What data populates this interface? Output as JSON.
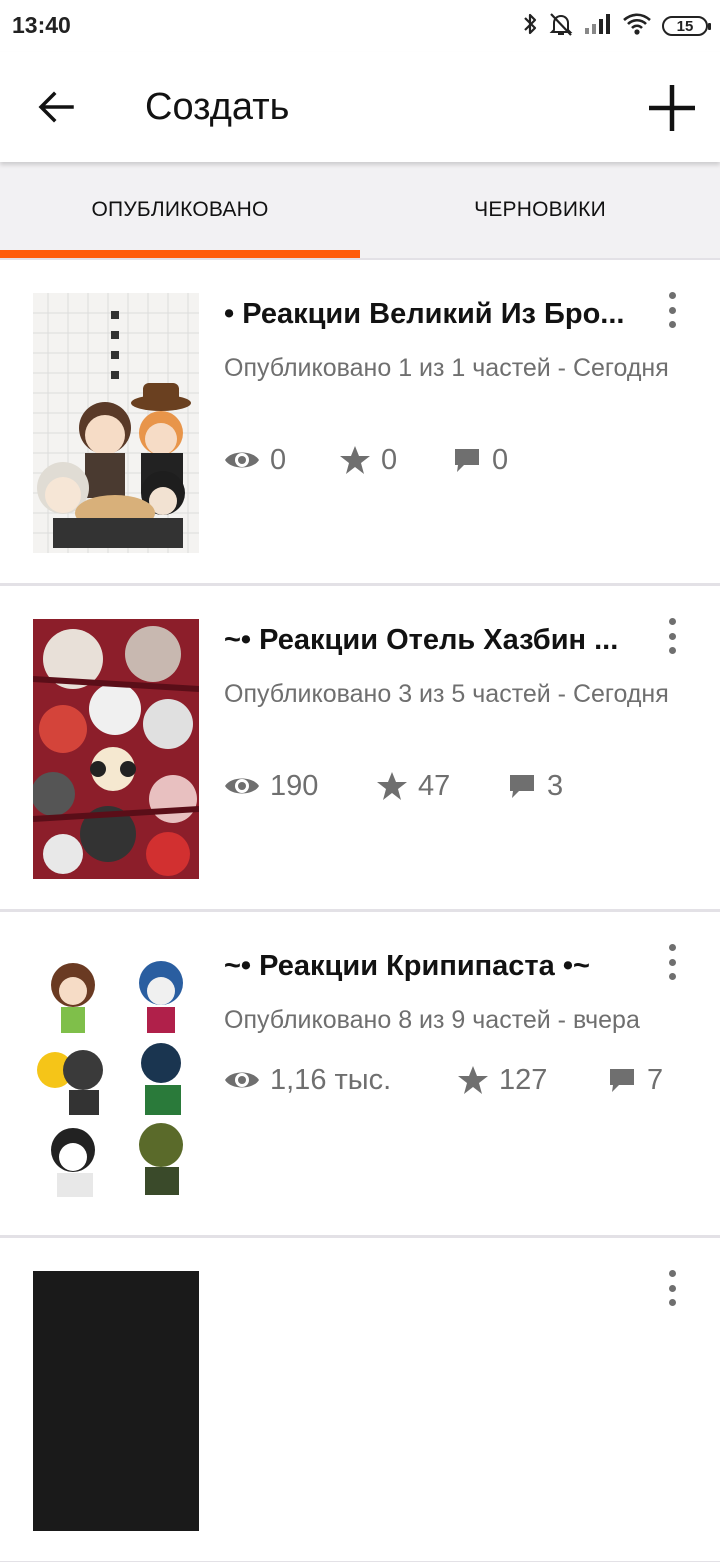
{
  "status_bar": {
    "time": "13:40",
    "battery": "15",
    "icons": [
      "bluetooth-icon",
      "bell-off-icon",
      "signal-icon",
      "wifi-icon",
      "battery-icon"
    ]
  },
  "app_bar": {
    "title": "Создать",
    "back_icon": "arrow-left-icon",
    "add_icon": "plus-icon"
  },
  "tabs": [
    {
      "label": "ОПУБЛИКОВАНО",
      "active": true
    },
    {
      "label": "ЧЕРНОВИКИ",
      "active": false
    }
  ],
  "colors": {
    "accent": "#ff5c0b",
    "text_primary": "#121212",
    "text_secondary": "#6f6f6f",
    "background": "#f0eff1"
  },
  "stories": [
    {
      "title": "• Реакции Великий Из Бро...",
      "meta": "Опубликовано 1 из 1 частей - Сегодня",
      "views": "0",
      "votes": "0",
      "comments": "0"
    },
    {
      "title": "~• Реакции Отель Хазбин ...",
      "meta": "Опубликовано 3 из 5 частей - Сегодня",
      "views": "190",
      "votes": "47",
      "comments": "3"
    },
    {
      "title": "~• Реакции Крипипаста •~",
      "meta": "Опубликовано 8 из 9 частей - вчера",
      "views": "1,16 тыс.",
      "votes": "127",
      "comments": "7"
    }
  ]
}
